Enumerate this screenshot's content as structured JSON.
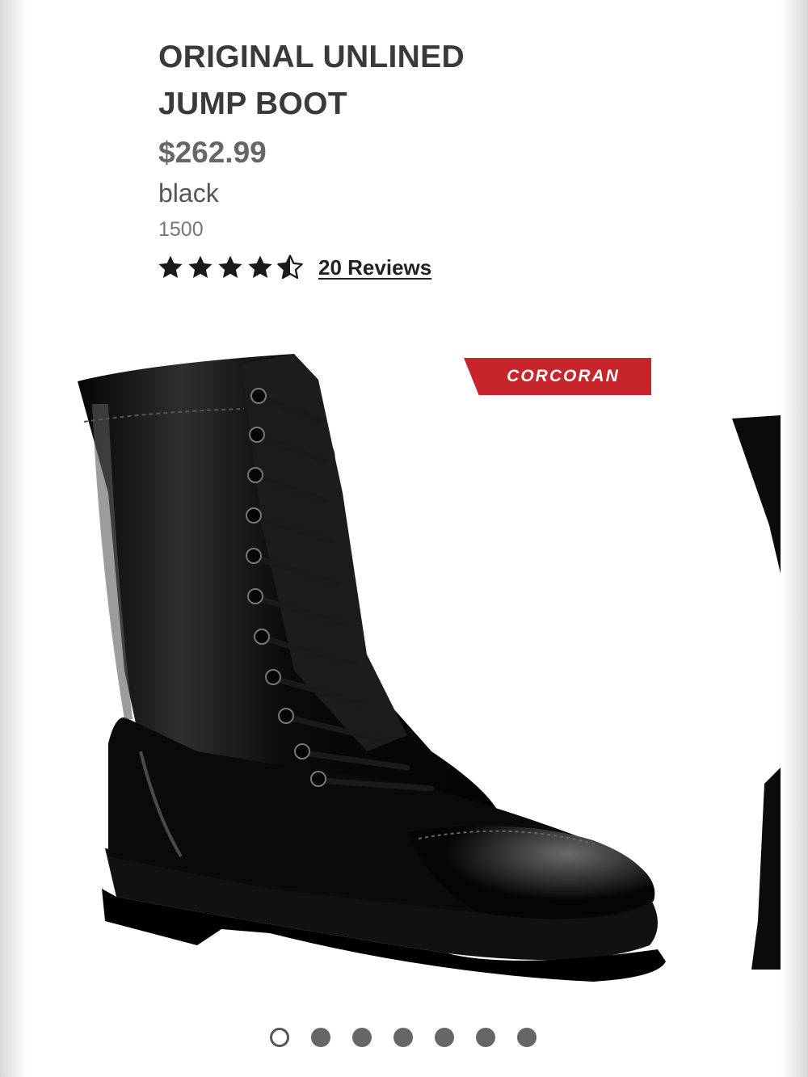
{
  "product": {
    "title_line1": "ORIGINAL UNLINED",
    "title_line2": "JUMP BOOT",
    "price": "$262.99",
    "color": "black",
    "sku": "1500"
  },
  "rating": {
    "value": 4.5,
    "max": 5,
    "reviews_label": "20 Reviews"
  },
  "gallery": {
    "brand_logo": "CORCORAN",
    "brand_color": "#c8242b",
    "image_count": 7,
    "active_index": 0
  }
}
